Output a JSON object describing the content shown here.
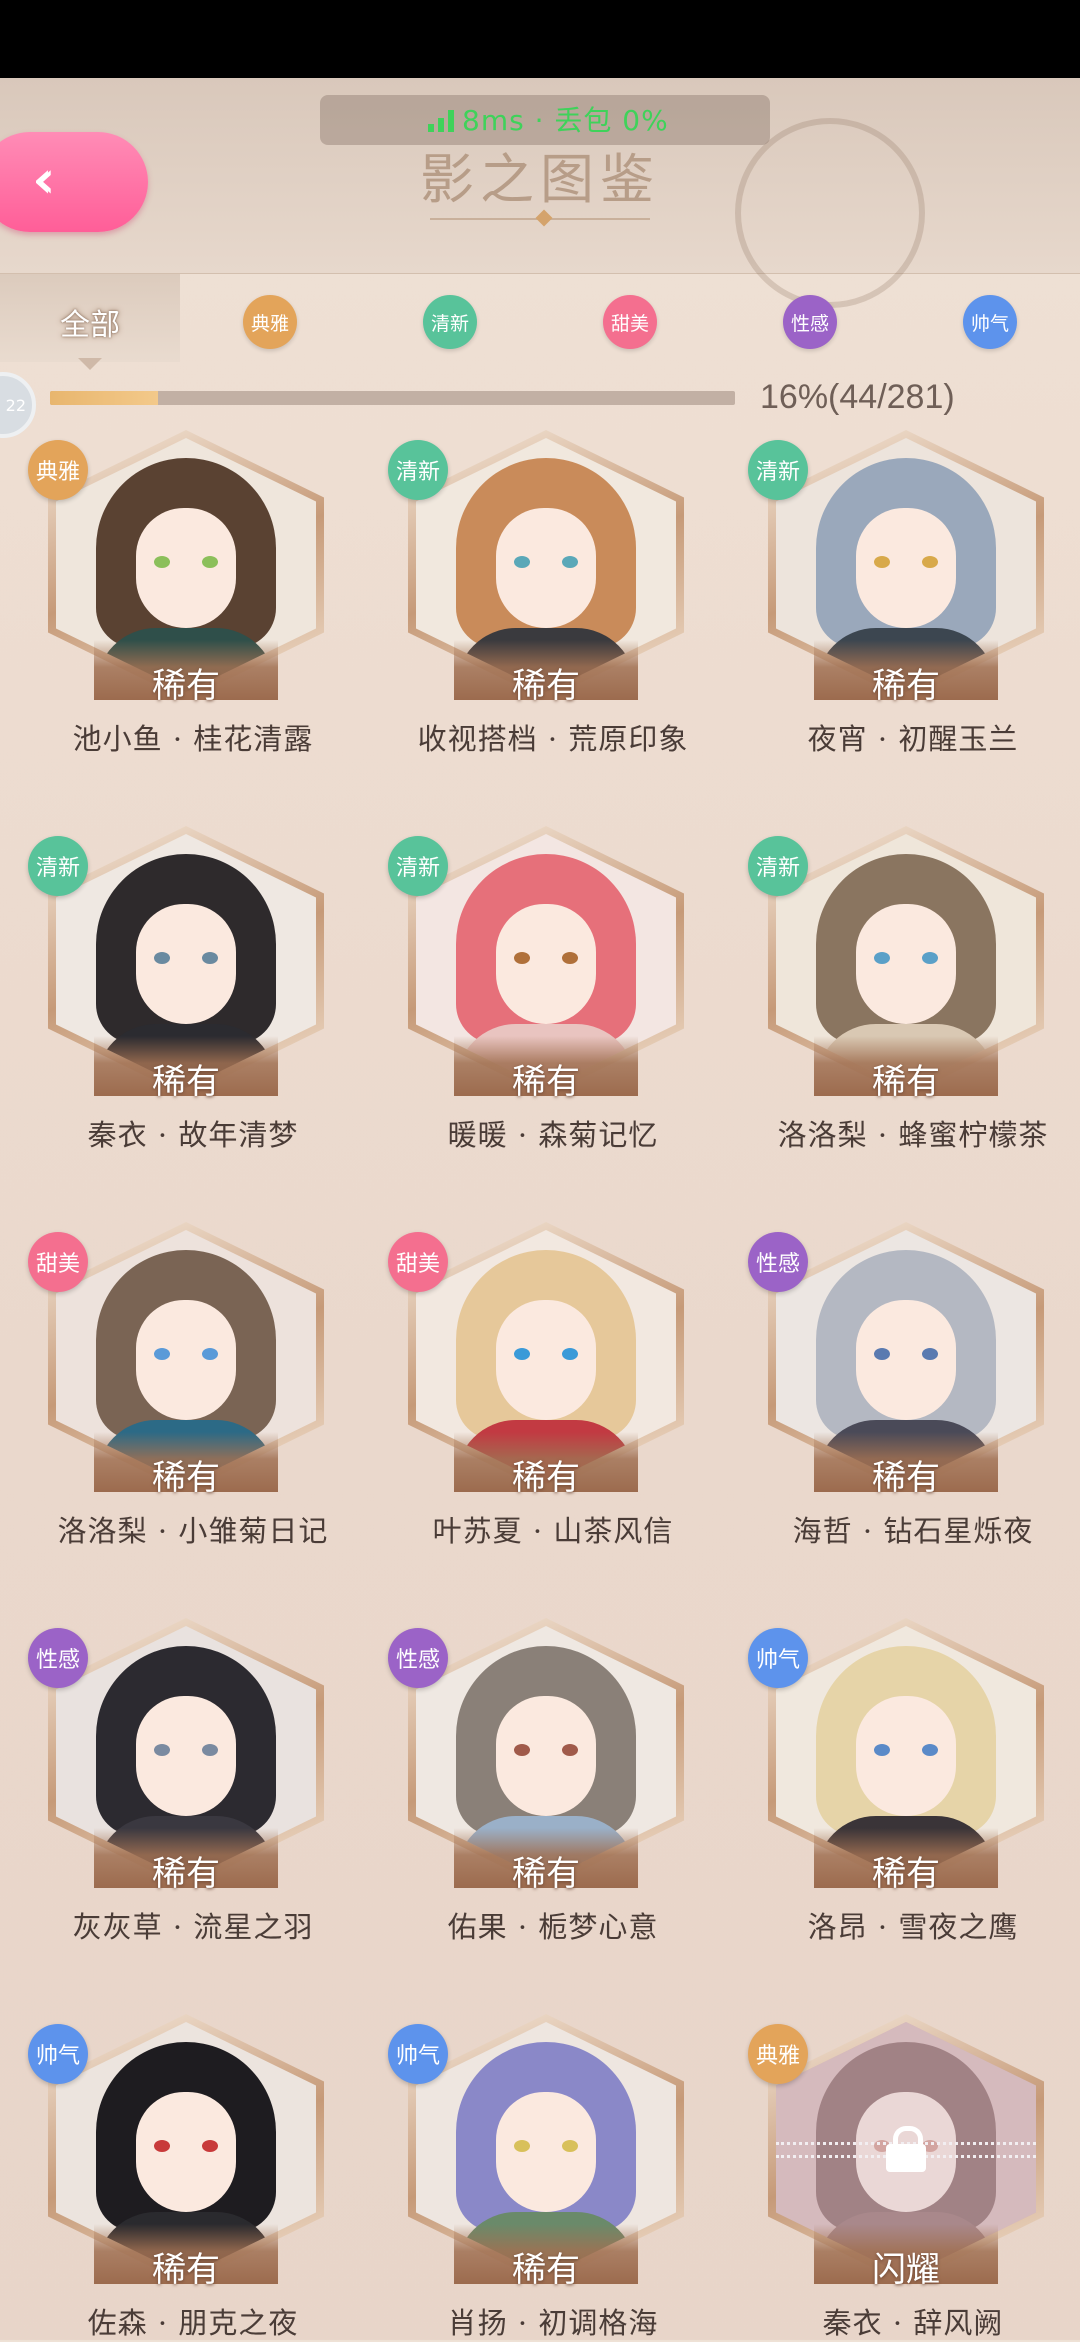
{
  "network": {
    "text": "8ms · 丢包 0%"
  },
  "header": {
    "title": "影之图鉴"
  },
  "filters": [
    {
      "label": "全部",
      "color": ""
    },
    {
      "label": "典雅",
      "color": "#e3a45a"
    },
    {
      "label": "清新",
      "color": "#58c39a"
    },
    {
      "label": "甜美",
      "color": "#f46f8f"
    },
    {
      "label": "性感",
      "color": "#9b63c7"
    },
    {
      "label": "帅气",
      "color": "#5d93ec"
    }
  ],
  "progress": {
    "level": "22",
    "text": "16%(44/281)",
    "fraction": 0.157
  },
  "cards": [
    {
      "badge": "典雅",
      "badge_color": "#e3a45a",
      "rarity": "稀有",
      "name": "池小鱼 · 桂花清露",
      "hair": "#5a4232",
      "outfit": "#2f4f4a",
      "eye": "#8bbf5a",
      "bg": "#efe6dc",
      "locked": false
    },
    {
      "badge": "清新",
      "badge_color": "#58c39a",
      "rarity": "稀有",
      "name": "收视搭档 · 荒原印象",
      "hair": "#c98b5a",
      "outfit": "#3a3a3e",
      "eye": "#5aa8b8",
      "bg": "#f1e8de",
      "locked": false
    },
    {
      "badge": "清新",
      "badge_color": "#58c39a",
      "rarity": "稀有",
      "name": "夜宵 · 初醒玉兰",
      "hair": "#9aa8bb",
      "outfit": "#3c4650",
      "eye": "#d8a94a",
      "bg": "#ede4dc",
      "locked": false
    },
    {
      "badge": "清新",
      "badge_color": "#58c39a",
      "rarity": "稀有",
      "name": "秦衣 · 故年清梦",
      "hair": "#2e2a2c",
      "outfit": "#2b2b30",
      "eye": "#6a8aa0",
      "bg": "#efe8e2",
      "locked": false
    },
    {
      "badge": "清新",
      "badge_color": "#58c39a",
      "rarity": "稀有",
      "name": "暖暖 · 森菊记忆",
      "hair": "#e6707a",
      "outfit": "#e9c4c0",
      "eye": "#b0703a",
      "bg": "#f3e6e2",
      "locked": false
    },
    {
      "badge": "清新",
      "badge_color": "#58c39a",
      "rarity": "稀有",
      "name": "洛洛梨 · 蜂蜜柠檬茶",
      "hair": "#8a7560",
      "outfit": "#d9c8b3",
      "eye": "#5aa0c8",
      "bg": "#efe6da",
      "locked": false
    },
    {
      "badge": "甜美",
      "badge_color": "#f46f8f",
      "rarity": "稀有",
      "name": "洛洛梨 · 小雏菊日记",
      "hair": "#7a6454",
      "outfit": "#2c6a86",
      "eye": "#5a9ad8",
      "bg": "#ede2dc",
      "locked": false
    },
    {
      "badge": "甜美",
      "badge_color": "#f46f8f",
      "rarity": "稀有",
      "name": "叶苏夏 · 山茶风信",
      "hair": "#e6c89a",
      "outfit": "#c23a42",
      "eye": "#3a9ad8",
      "bg": "#f2e8e0",
      "locked": false
    },
    {
      "badge": "性感",
      "badge_color": "#9b63c7",
      "rarity": "稀有",
      "name": "海哲 · 钻石星烁夜",
      "hair": "#b4b8c2",
      "outfit": "#4a4a58",
      "eye": "#5a7ab0",
      "bg": "#ece6e2",
      "locked": false
    },
    {
      "badge": "性感",
      "badge_color": "#9b63c7",
      "rarity": "稀有",
      "name": "灰灰草 · 流星之羽",
      "hair": "#2c2a30",
      "outfit": "#3a3840",
      "eye": "#7a8aa0",
      "bg": "#e9e2df",
      "locked": false
    },
    {
      "badge": "性感",
      "badge_color": "#9b63c7",
      "rarity": "稀有",
      "name": "佑果 · 栀梦心意",
      "hair": "#8a8078",
      "outfit": "#9ab0c8",
      "eye": "#a05a4a",
      "bg": "#efe8e2",
      "locked": false
    },
    {
      "badge": "帅气",
      "badge_color": "#5d93ec",
      "rarity": "稀有",
      "name": "洛昂 · 雪夜之鹰",
      "hair": "#e6d4a8",
      "outfit": "#3a3438",
      "eye": "#5a8ac8",
      "bg": "#f0e8de",
      "locked": false
    },
    {
      "badge": "帅气",
      "badge_color": "#5d93ec",
      "rarity": "稀有",
      "name": "佐森 · 朋克之夜",
      "hair": "#1e1c20",
      "outfit": "#2a2a2e",
      "eye": "#c83a3a",
      "bg": "#ece4de",
      "locked": false
    },
    {
      "badge": "帅气",
      "badge_color": "#5d93ec",
      "rarity": "稀有",
      "name": "肖扬 · 初调格海",
      "hair": "#8a88c8",
      "outfit": "#6a8a6a",
      "eye": "#d8c05a",
      "bg": "#eee6e0",
      "locked": false
    },
    {
      "badge": "典雅",
      "badge_color": "#e3a45a",
      "rarity": "闪耀",
      "name": "秦衣 · 辞风阙",
      "hair": "#5a2e2e",
      "outfit": "#6a3a3a",
      "eye": "#c87a6a",
      "bg": "#cda8a8",
      "locked": true
    }
  ]
}
